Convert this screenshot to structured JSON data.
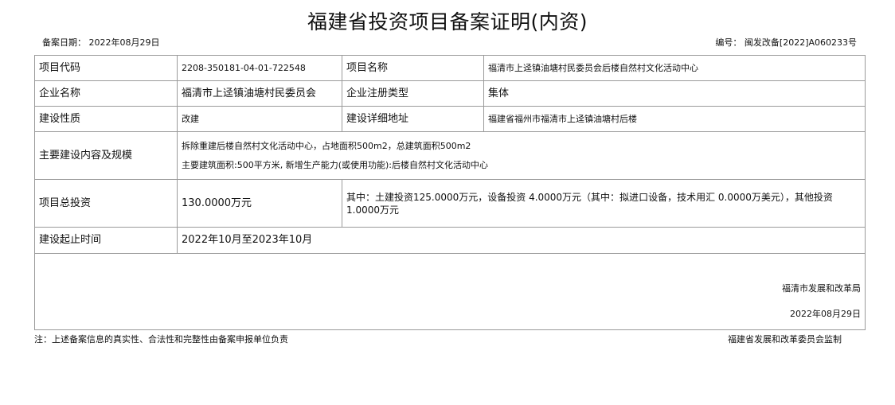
{
  "title": "福建省投资项目备案证明(内资)",
  "record_date": "备案日期：  2022年08月29日",
  "doc_number": "编号：  闽发改备[2022]A060233号",
  "rows": {
    "project_code": {
      "label": "项目代码",
      "value": "2208-350181-04-01-722548"
    },
    "project_name": {
      "label": "项目名称",
      "value": "福清市上迳镇油塘村民委员会后楼自然村文化活动中心"
    },
    "enterprise_name": {
      "label": "企业名称",
      "value": "福清市上迳镇油塘村民委员会"
    },
    "registration_type": {
      "label": "企业注册类型",
      "value": "集体"
    },
    "construction_nature": {
      "label": "建设性质",
      "value": "改建"
    },
    "address": {
      "label": "建设详细地址",
      "value": "福建省福州市福清市上迳镇油塘村后楼"
    },
    "content_scale": {
      "label": "主要建设内容及规模",
      "line1": "拆除重建后楼自然村文化活动中心，占地面积500m2，总建筑面积500m2",
      "line2": "主要建筑面积:500平方米, 新增生产能力(或使用功能):后楼自然村文化活动中心"
    },
    "total_investment": {
      "label": "项目总投资",
      "value": "130.0000万元",
      "breakdown": "其中：土建投资125.0000万元，设备投资 4.0000万元（其中：拟进口设备，技术用汇 0.0000万美元），其他投资1.0000万元"
    },
    "period": {
      "label": "建设起止时间",
      "value": "2022年10月至2023年10月"
    }
  },
  "issuer": "福清市发展和改革局",
  "issue_date": "2022年08月29日",
  "note_left": "注：上述备案信息的真实性、合法性和完整性由备案申报单位负责",
  "note_right": "福建省发展和改革委员会监制"
}
